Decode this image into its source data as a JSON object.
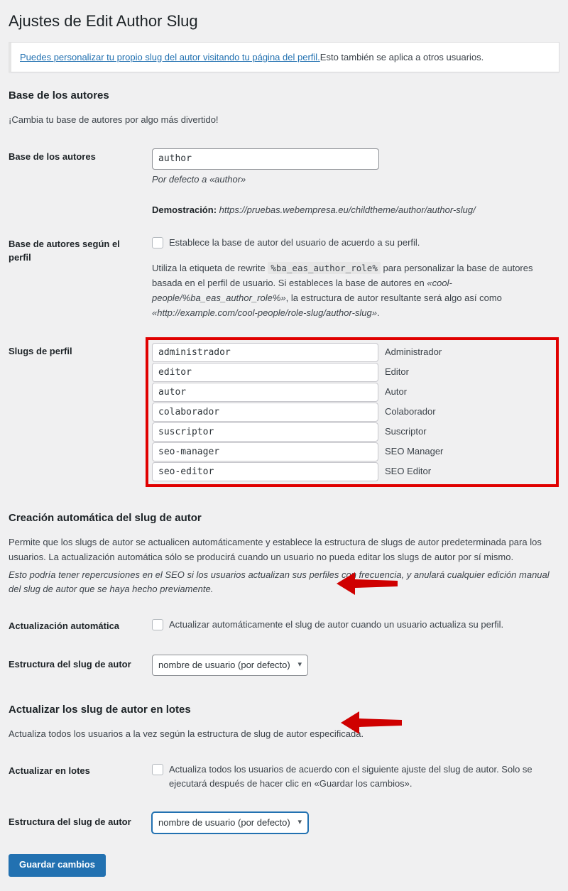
{
  "page": {
    "title": "Ajustes de Edit Author Slug"
  },
  "notice": {
    "link_text": "Puedes personalizar tu propio slug del autor visitando tu página del perfil.",
    "rest_text": "Esto también se aplica a otros usuarios."
  },
  "colors": {
    "accent_blue": "#2271b1",
    "annotation_red": "#e00000",
    "page_background": "#f0f0f1",
    "heading": "#1d2327"
  },
  "section_author_base": {
    "heading": "Base de los autores",
    "description": "¡Cambia tu base de autores por algo más divertido!",
    "base_label": "Base de los autores",
    "base_value": "author",
    "base_help": "Por defecto a «author»",
    "demo_label": "Demostración:",
    "demo_url": "https://pruebas.webempresa.eu/childtheme/author/author-slug/",
    "role_based_label": "Base de autores según el perfil",
    "role_based_checkbox_label": "Establece la base de autor del usuario de acuerdo a su perfil.",
    "role_based_checked": false,
    "role_based_help_1": "Utiliza la etiqueta de rewrite",
    "role_based_code": "%ba_eas_author_role%",
    "role_based_help_2": "para personalizar la base de autores basada en el perfil de usuario. Si estableces la base de autores en ",
    "role_based_help_italic_1": "«cool-people/%ba_eas_author_role%»",
    "role_based_help_3": ", la estructura de autor resultante será algo así como ",
    "role_based_help_italic_2": "«http://example.com/cool-people/role-slug/author-slug»",
    "role_based_help_4": "."
  },
  "profile_slugs": {
    "label": "Slugs de perfil",
    "rows": [
      {
        "value": "administrador",
        "role": "Administrador"
      },
      {
        "value": "editor",
        "role": "Editor"
      },
      {
        "value": "autor",
        "role": "Autor"
      },
      {
        "value": "colaborador",
        "role": "Colaborador"
      },
      {
        "value": "suscriptor",
        "role": "Suscriptor"
      },
      {
        "value": "seo-manager",
        "role": "SEO Manager"
      },
      {
        "value": "seo-editor",
        "role": "SEO Editor"
      }
    ]
  },
  "section_auto": {
    "heading": "Creación automática del slug de autor",
    "description_1": "Permite que los slugs de autor se actualicen automáticamente y establece la estructura de slugs de autor predeterminada para los usuarios. La actualización automática sólo se producirá cuando un usuario no pueda editar los slugs de autor por sí mismo.",
    "description_2_italic": "Esto podría tener repercusiones en el SEO si los usuarios actualizan sus perfiles con frecuencia, y anulará cualquier edición manual del slug de autor que se haya hecho previamente.",
    "auto_update_label": "Actualización automática",
    "auto_update_checkbox_label": "Actualizar automáticamente el slug de autor cuando un usuario actualiza su perfil.",
    "auto_update_checked": false,
    "structure_label": "Estructura del slug de autor",
    "structure_value": "nombre de usuario (por defecto)",
    "structure_options": [
      "nombre de usuario (por defecto)"
    ]
  },
  "section_bulk": {
    "heading": "Actualizar los slug de autor en lotes",
    "description": "Actualiza todos los usuarios a la vez según la estructura de slug de autor especificada.",
    "bulk_label": "Actualizar en lotes",
    "bulk_checkbox_label": "Actualiza todos los usuarios de acuerdo con el siguiente ajuste del slug de autor. Solo se ejecutará después de hacer clic en «Guardar los cambios».",
    "bulk_checked": false,
    "structure_label": "Estructura del slug de autor",
    "structure_value": "nombre de usuario (por defecto)",
    "structure_options": [
      "nombre de usuario (por defecto)"
    ]
  },
  "submit": {
    "label": "Guardar cambios"
  },
  "annotations": {
    "red_box_target": "profile-slugs-table",
    "arrow_1_target": "auto-structure-select",
    "arrow_2_target": "bulk-structure-select"
  }
}
